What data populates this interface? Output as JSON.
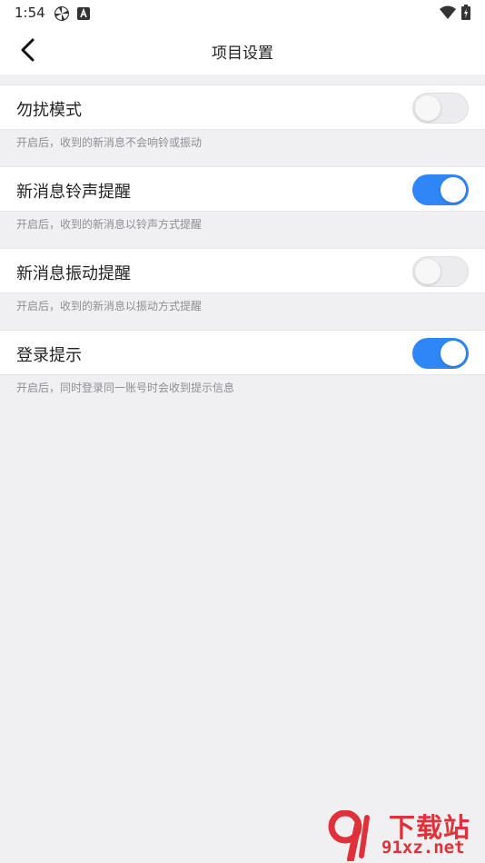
{
  "status_bar": {
    "time": "1:54"
  },
  "header": {
    "title": "项目设置"
  },
  "settings": [
    {
      "label": "勿扰模式",
      "enabled": false,
      "hint": "开启后，收到的新消息不会响铃或振动"
    },
    {
      "label": "新消息铃声提醒",
      "enabled": true,
      "hint": "开启后，收到的新消息以铃声方式提醒"
    },
    {
      "label": "新消息振动提醒",
      "enabled": false,
      "hint": "开启后，收到的新消息以振动方式提醒"
    },
    {
      "label": "登录提示",
      "enabled": true,
      "hint": "开启后，同时登录同一账号时会收到提示信息"
    }
  ],
  "watermark": {
    "logo_text": "91",
    "top_text": "下载站",
    "bottom_text": "91xz.net"
  },
  "colors": {
    "toggle_on": "#2f86f6",
    "toggle_off": "#ececee",
    "watermark": "#e0303a"
  }
}
